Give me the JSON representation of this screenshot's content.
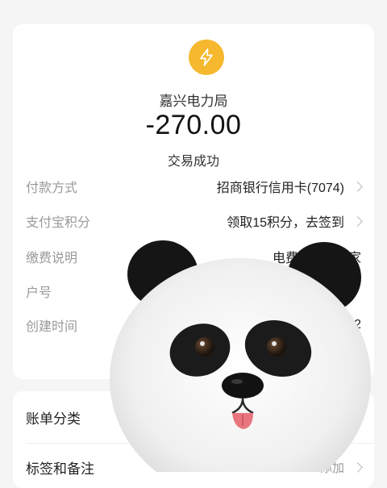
{
  "header": {
    "merchant_icon": "lightning-icon",
    "merchant_name": "嘉兴电力局",
    "amount": "-270.00",
    "status": "交易成功"
  },
  "details": [
    {
      "label": "付款方式",
      "value": "招商银行信用卡(7074)",
      "has_chevron": true
    },
    {
      "label": "支付宝积分",
      "value": "领取15积分，去签到",
      "has_chevron": true
    },
    {
      "label": "缴费说明",
      "value": "电费",
      "value_tail": "我家",
      "has_chevron": false
    },
    {
      "label": "户号",
      "value": "",
      "has_chevron": false
    },
    {
      "label": "创建时间",
      "value": "22",
      "has_chevron": false
    }
  ],
  "bottom": {
    "category_label": "账单分类",
    "tags_label": "标签和备注",
    "tags_value": "添加"
  },
  "colors": {
    "page_bg": "#f5f5f5",
    "card_bg": "#ffffff",
    "accent_icon": "#f5b82e",
    "label_gray": "#9a9a9a"
  },
  "overlay": "panda-face-sticker"
}
